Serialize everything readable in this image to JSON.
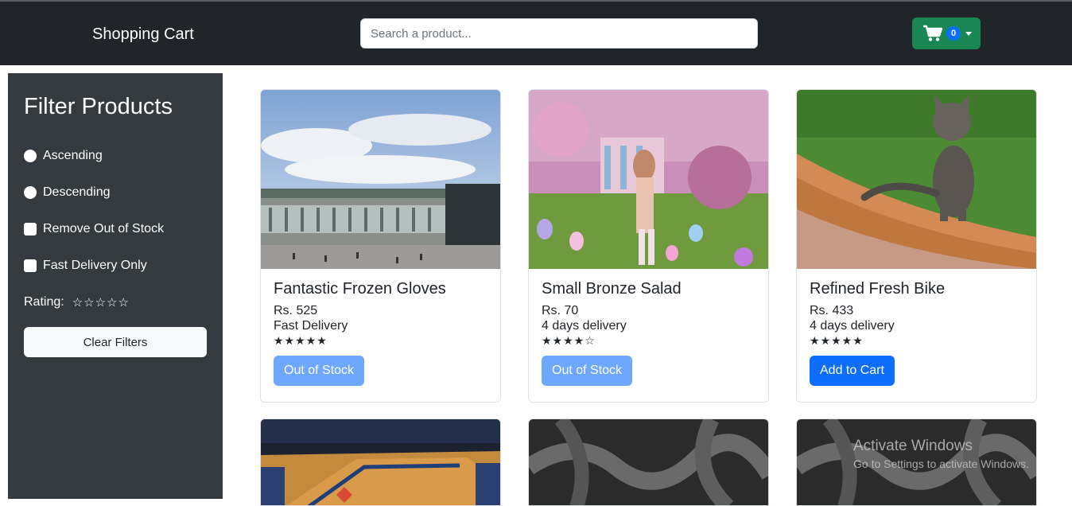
{
  "navbar": {
    "brand": "Shopping Cart",
    "search_placeholder": "Search a product...",
    "cart_count": "0",
    "cart_icon": "cart-icon"
  },
  "sidebar": {
    "title": "Filter Products",
    "options": [
      {
        "label": "Ascending",
        "type": "radio"
      },
      {
        "label": "Descending",
        "type": "radio"
      },
      {
        "label": "Remove Out of Stock",
        "type": "checkbox"
      },
      {
        "label": "Fast Delivery Only",
        "type": "checkbox"
      }
    ],
    "rating_label": "Rating:",
    "rating_stars": "☆☆☆☆☆",
    "clear_label": "Clear Filters"
  },
  "products": [
    {
      "name": "Fantastic Frozen Gloves",
      "price": "Rs. 525",
      "delivery": "Fast Delivery",
      "stars": "★★★★★",
      "rating": 5,
      "button": "Out of Stock",
      "in_stock": false
    },
    {
      "name": "Small Bronze Salad",
      "price": "Rs. 70",
      "delivery": "4 days delivery",
      "stars": "★★★★☆",
      "rating": 4,
      "button": "Out of Stock",
      "in_stock": false
    },
    {
      "name": "Refined Fresh Bike",
      "price": "Rs. 433",
      "delivery": "4 days delivery",
      "stars": "★★★★★",
      "rating": 5,
      "button": "Add to Cart",
      "in_stock": true
    }
  ],
  "watermark": {
    "line1": "Activate Windows",
    "line2": "Go to Settings to activate Windows."
  },
  "colors": {
    "navbar": "#212529",
    "sidebar": "#343a40",
    "cart_button": "#198754",
    "primary": "#0d6efd",
    "disabled_primary": "#6ea8fe"
  }
}
